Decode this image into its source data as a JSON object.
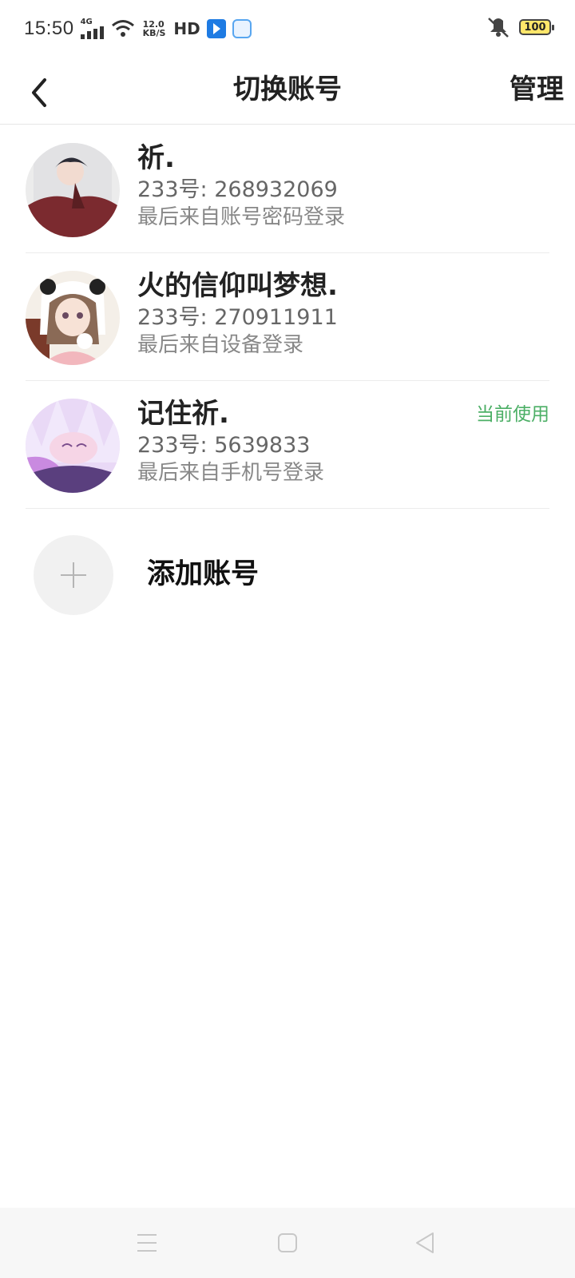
{
  "status_bar": {
    "time": "15:50",
    "network": "4G",
    "speed_value": "12.0",
    "speed_unit": "KB/S",
    "hd": "HD",
    "battery": "100",
    "icons": [
      "signal-icon",
      "wifi-icon",
      "app-icon",
      "browser-icon",
      "mute-vibrate-icon",
      "battery-icon"
    ]
  },
  "header": {
    "title": "切换账号",
    "manage": "管理"
  },
  "accounts": [
    {
      "name": "祈.",
      "id": "233号: 268932069",
      "source": "最后来自账号密码登录",
      "current": false,
      "colors": [
        "#e6e6e6",
        "#7b2a2f",
        "#2b2b35"
      ]
    },
    {
      "name": "火的信仰叫梦想.",
      "id": "233号: 270911911",
      "source": "最后来自设备登录",
      "current": false,
      "colors": [
        "#f4efe8",
        "#8a6a56",
        "#f2b7bd"
      ]
    },
    {
      "name": "记住祈.",
      "id": "233号: 5639833",
      "source": "最后来自手机号登录",
      "current": true,
      "current_label": "当前使用",
      "colors": [
        "#e9d9f6",
        "#b488d8",
        "#5a3f7e"
      ]
    }
  ],
  "add_account": {
    "label": "添加账号"
  },
  "nav_bar": {
    "icons": [
      "menu-icon",
      "home-icon",
      "back-icon"
    ]
  },
  "theme": {
    "accent_green": "#4caf66",
    "text_dark": "#222222",
    "text_muted": "#888888"
  }
}
